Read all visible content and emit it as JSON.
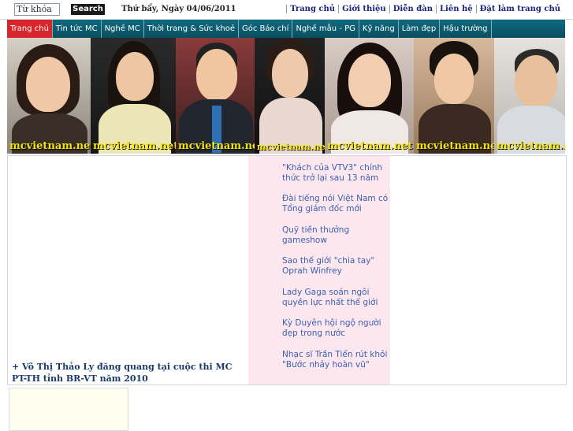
{
  "topbar": {
    "search_placeholder": "Từ khóa",
    "search_button": "Search",
    "date": "Thứ bẩy, Ngày 04/06/2011",
    "links": [
      "Trang chủ",
      "Giới thiệu",
      "Diễn đàn",
      "Liên hệ",
      "Đặt làm trang chủ"
    ]
  },
  "nav": {
    "tabs": [
      "Trang chủ",
      "Tin tức MC",
      "Nghề MC",
      "Thời trang & Sức khoẻ",
      "Góc Báo chí",
      "Nghề mẫu - PG",
      "Kỹ năng",
      "Làm đẹp",
      "Hậu trường"
    ],
    "active_color": "#d8242c",
    "bar_color": "#0f6a7f"
  },
  "banner": {
    "watermark": "mcvietnam.net",
    "photos": 7
  },
  "featured": {
    "text": "+ Võ Thị Thảo Ly đăng quang tại cuộc thi MC PT-TH tỉnh BR-VT năm 2010"
  },
  "news": [
    "\"Khách của VTV3\" chính thức trở lại sau 13 năm",
    "Đài tiếng nói Việt Nam có Tổng giám đốc mới",
    "Quỹ tiền thưởng gameshow",
    "Sao thế giới \"chia tay\" Oprah Winfrey",
    "Lady Gaga soán ngôi quyền lực nhất thế giới",
    "Kỳ Duyên hội ngộ người đẹp trong nước",
    "Nhạc sĩ Trần Tiến rút khỏi \"Bước nhảy hoàn vũ\""
  ]
}
